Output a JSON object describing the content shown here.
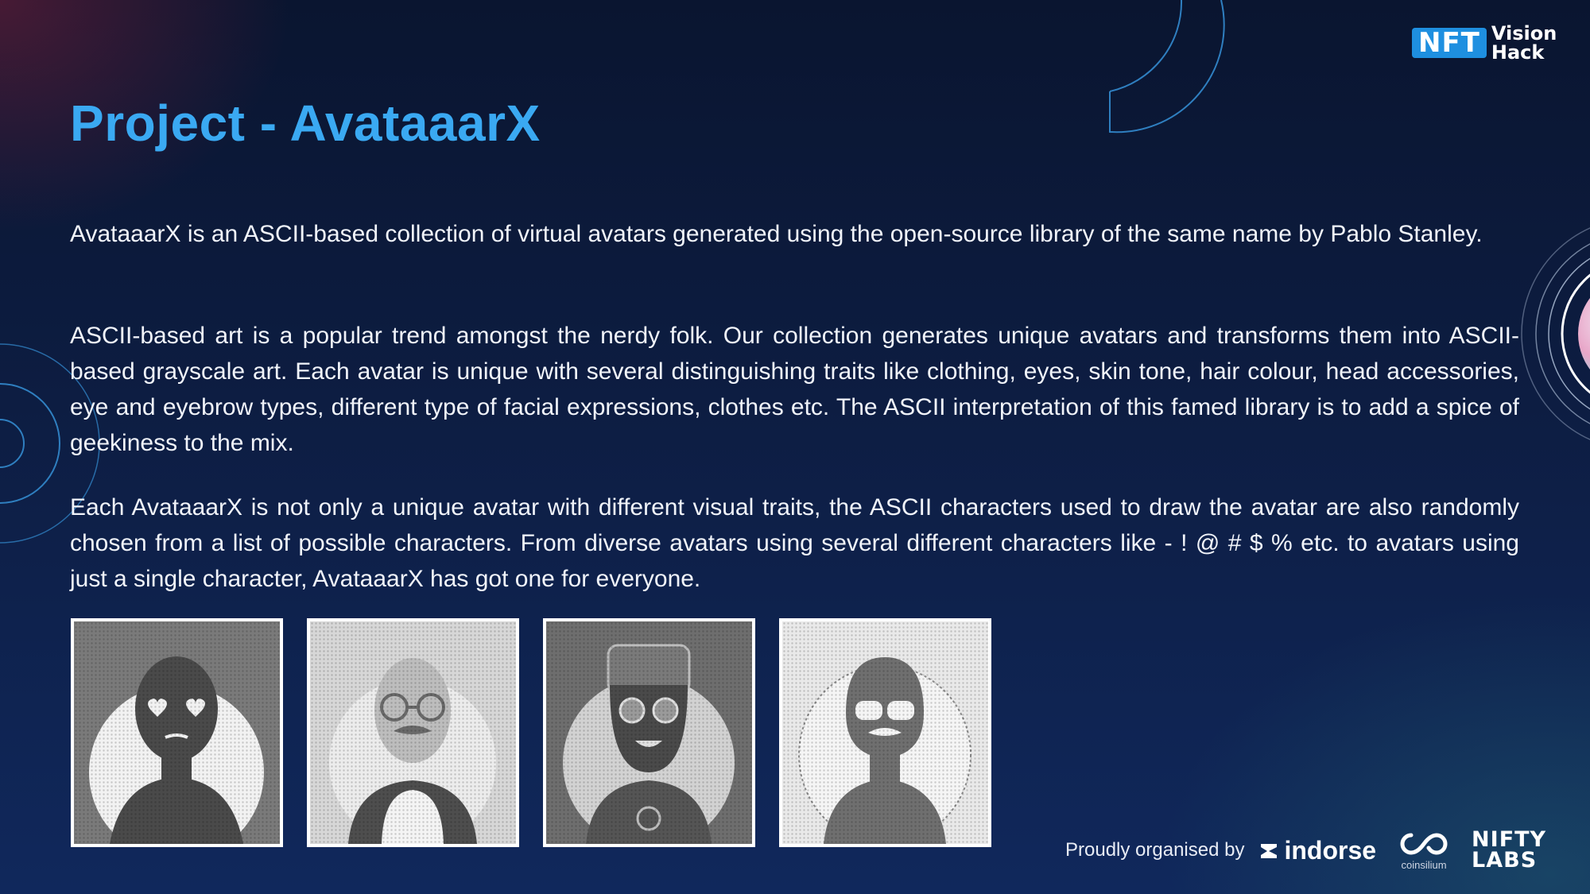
{
  "logo": {
    "nft": "NFT",
    "vision": "Vision",
    "hack": "Hack"
  },
  "title": "Project - AvataaarX",
  "paragraphs": {
    "p1": "AvataaarX is an ASCII-based collection of virtual avatars generated using the open-source library of the same name by Pablo Stanley.",
    "p2": "ASCII-based art is a popular trend amongst the nerdy folk. Our collection generates unique avatars and transforms them into ASCII-based grayscale art. Each avatar is unique with several distinguishing traits like clothing, eyes, skin tone, hair colour, head accessories, eye and eyebrow types, different type of facial expressions, clothes etc. The ASCII interpretation of this famed library is to add a spice of geekiness to the mix.",
    "p3": "Each AvataaarX is not only a unique avatar with different visual traits, the ASCII characters used to draw the avatar are also randomly chosen from a list of possible characters. From diverse avatars using several different characters like - ! @ # $ % etc. to avatars using just a single character, AvataaarX has got one for everyone."
  },
  "avatars": [
    {
      "style": "heart-eyes",
      "bg": "#7a7a7a"
    },
    {
      "style": "glasses-mustache",
      "bg": "#d7d7d7"
    },
    {
      "style": "beard-glasses",
      "bg": "#6e6e6e"
    },
    {
      "style": "sunglasses-mustache",
      "bg": "#e9e9e9"
    }
  ],
  "footer": {
    "organised_by": "Proudly organised by",
    "indorse": "indorse",
    "coinsilium": "coinsilium",
    "nifty_line1": "NIFTY",
    "nifty_line2": "LABS"
  },
  "colors": {
    "accent": "#3aa9f2",
    "text": "#f1f4fa",
    "frame": "#ffffff"
  }
}
